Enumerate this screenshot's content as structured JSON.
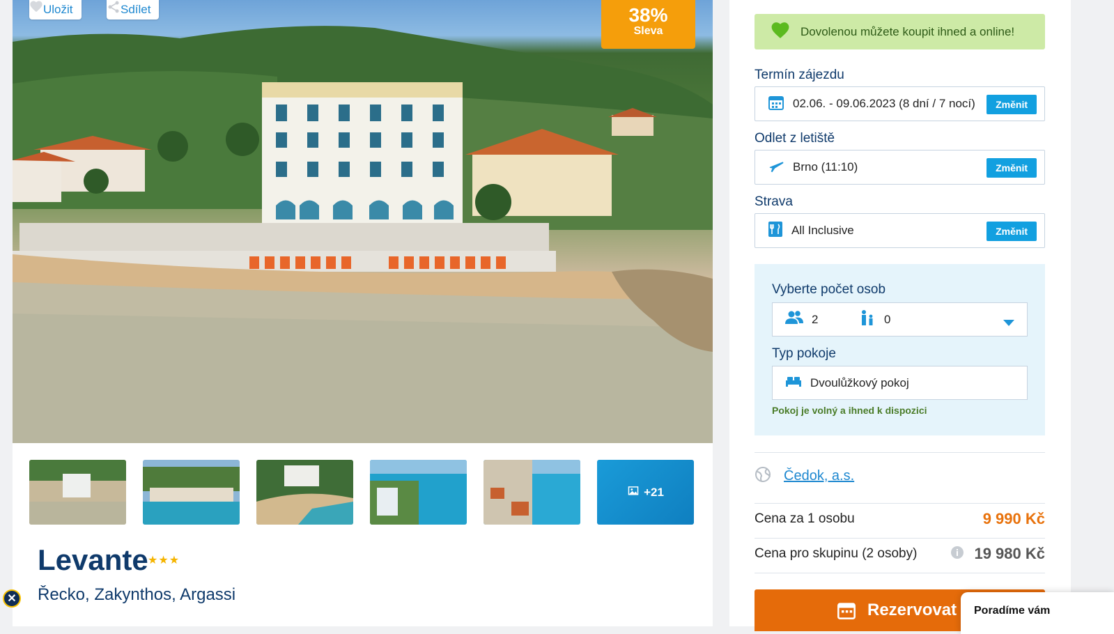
{
  "hero": {
    "save_label": "Uložit",
    "share_label": "Sdílet",
    "discount_pct": "38%",
    "discount_label": "Sleva",
    "more_photos": "+21"
  },
  "hotel": {
    "name": "Levante",
    "stars": 3,
    "stars_text": "★★★",
    "location": "Řecko, Zakynthos, Argassi"
  },
  "sidebar": {
    "online_banner": "Dovolenou můžete koupit ihned a online!",
    "term_label": "Termín zájezdu",
    "term_value": "02.06. - 09.06.2023 (8 dní / 7 nocí)",
    "departure_label": "Odlet z letiště",
    "departure_value": "Brno (11:10)",
    "board_label": "Strava",
    "board_value": "All Inclusive",
    "change_label": "Změnit",
    "persons_label": "Vyberte počet osob",
    "adults": "2",
    "children": "0",
    "room_label": "Typ pokoje",
    "room_value": "Dvoulůžkový pokoj",
    "availability": "Pokoj je volný a ihned k dispozici",
    "operator": "Čedok, a.s.",
    "price_per_person_label": "Cena za 1 osobu",
    "price_per_person": "9 990 Kč",
    "price_group_label": "Cena pro skupinu (2 osoby)",
    "price_group": "19 980 Kč",
    "book_label": "Rezervovat"
  },
  "chat": {
    "text": "Poradíme vám"
  },
  "colors": {
    "accent_blue": "#12a0e0",
    "discount_orange": "#f59e0b",
    "price_orange": "#e8720c",
    "navy": "#0f3a6b"
  }
}
